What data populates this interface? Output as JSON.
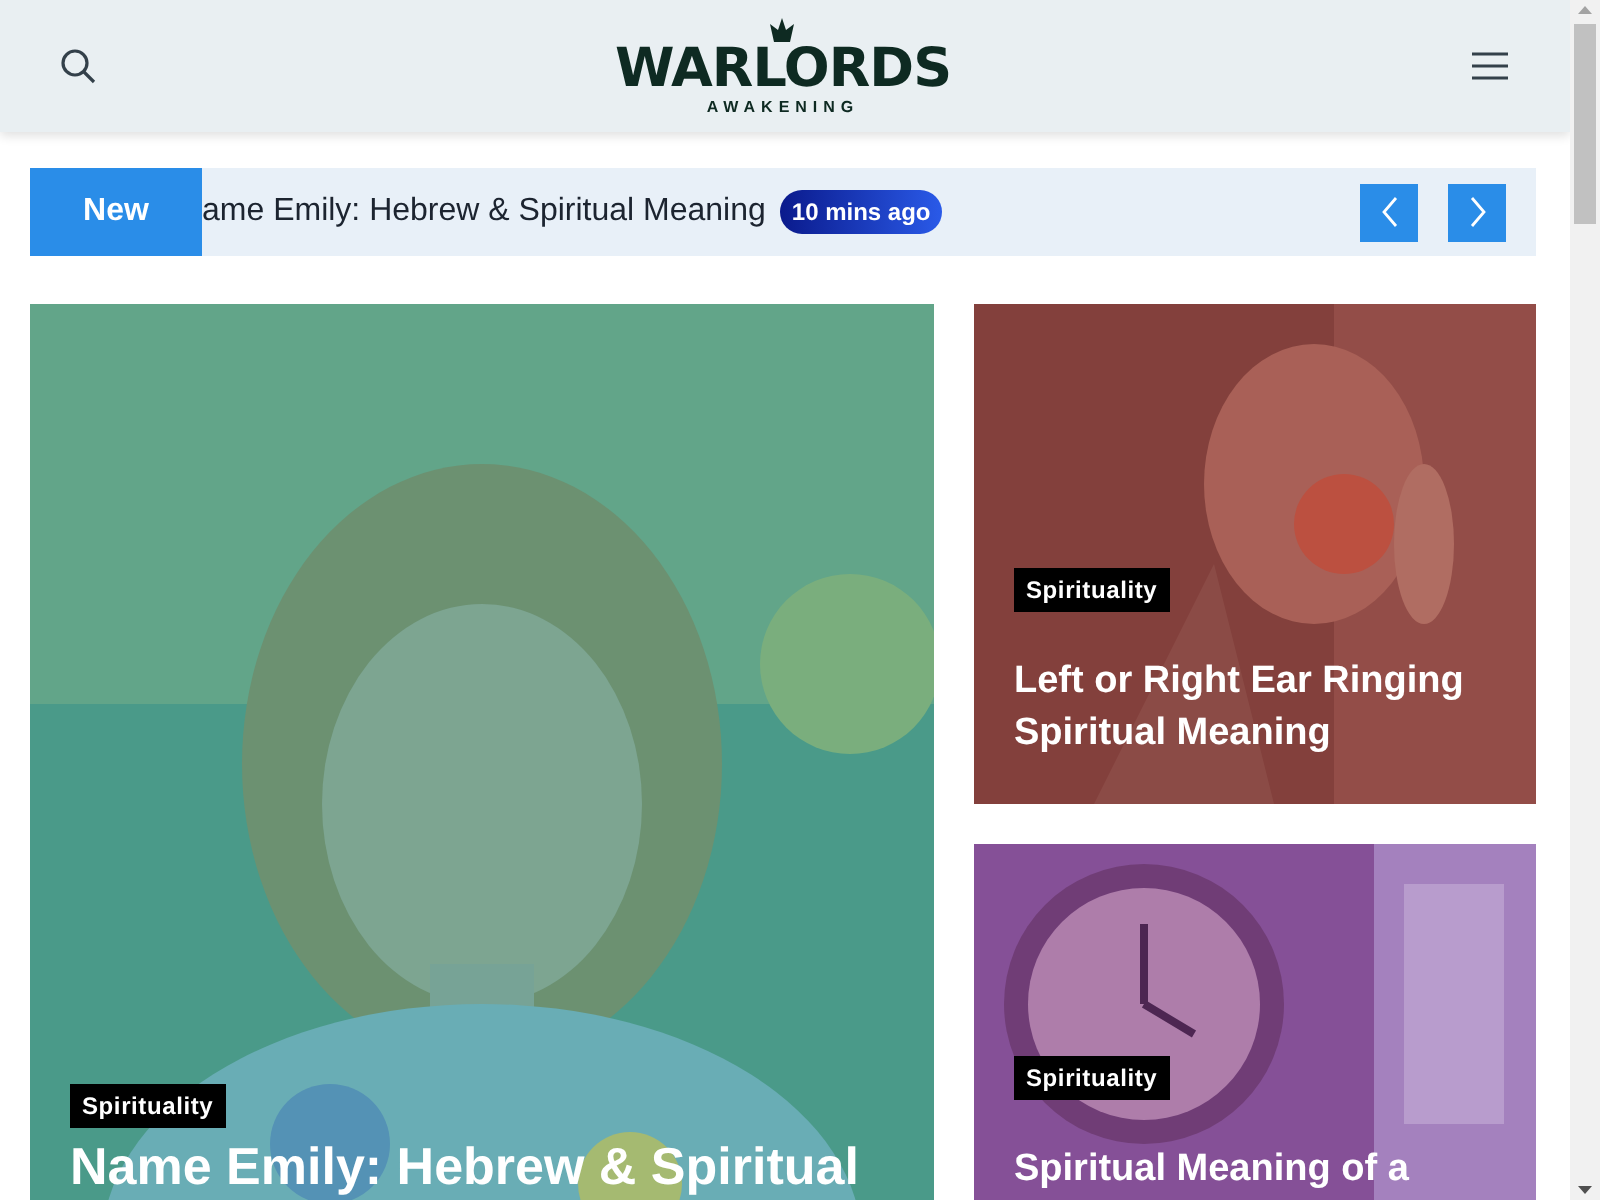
{
  "header": {
    "logo": {
      "title": "WARLORDS",
      "subtitle": "AWAKENING"
    }
  },
  "ticker": {
    "label": "New",
    "headline": "ame Emily: Hebrew & Spiritual Meaning",
    "time": "10 mins ago"
  },
  "posts": [
    {
      "kind": "large",
      "category": "Spirituality",
      "title": "Name Emily: Hebrew & Spiritual"
    },
    {
      "kind": "small",
      "category": "Spirituality",
      "title": "Left or Right Ear Ringing Spiritual Meaning"
    },
    {
      "kind": "small",
      "category": "Spirituality",
      "title": "Spiritual Meaning of a"
    }
  ]
}
